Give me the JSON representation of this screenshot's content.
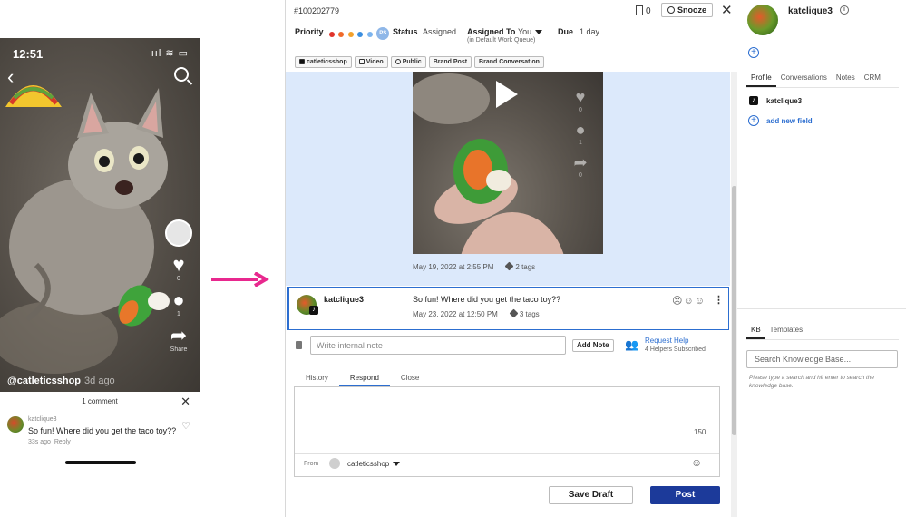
{
  "phone": {
    "time": "12:51",
    "status_icons": "ııl ≋ ▭",
    "handle": "@catleticsshop",
    "handle_age": "3d ago",
    "like_count": "0",
    "comment_count": "1",
    "share_label": "Share",
    "comments_sheet": {
      "title": "1 comment",
      "username": "katclique3",
      "text": "So fun! Where did you get the taco toy??",
      "age": "33s ago",
      "reply_label": "Reply"
    }
  },
  "ticket": {
    "id": "#100202779",
    "bookmark_count": "0",
    "snooze_label": "Snooze",
    "priority_label": "Priority",
    "priority_dots": [
      "#e0342b",
      "#f06a2b",
      "#f3a12b",
      "#3a8ee0",
      "#7cb4ee"
    ],
    "priority_avatar": "PS",
    "status_label": "Status",
    "status_value": "Assigned",
    "assigned_label": "Assigned To",
    "assigned_value": "You",
    "assigned_sub": "(in Default Work Queue)",
    "due_label": "Due",
    "due_value": "1 day",
    "tags": [
      "catleticsshop",
      "Video",
      "Public",
      "Brand Post",
      "Brand Conversation"
    ],
    "post": {
      "date": "May 19, 2022 at 2:55 PM",
      "tag_count": "2 tags",
      "like_count": "0",
      "comment_count": "1",
      "share_count": "0"
    },
    "comment": {
      "username": "katclique3",
      "text": "So fun! Where did you get the taco toy??",
      "date": "May 23, 2022 at 12:50 PM",
      "tag_count": "3 tags"
    },
    "note_placeholder": "Write internal note",
    "add_note_label": "Add Note",
    "request_help_label": "Request Help",
    "helpers_label": "4 Helpers Subscribed",
    "tabs": [
      "History",
      "Respond",
      "Close"
    ],
    "active_tab": "Respond",
    "char_count": "150",
    "from_label": "From",
    "from_account": "catleticsshop",
    "save_draft_label": "Save Draft",
    "post_label": "Post"
  },
  "profile": {
    "name": "katclique3",
    "tabs": [
      "Profile",
      "Conversations",
      "Notes",
      "CRM"
    ],
    "active_tab": "Profile",
    "tiktok_handle": "katclique3",
    "add_field_label": "add new field",
    "kb_tabs": [
      "KB",
      "Templates"
    ],
    "kb_search_placeholder": "Search Knowledge Base...",
    "kb_hint": "Please type a search and hit enter to search the knowledge base."
  },
  "colors": {
    "accent": "#2c6ed0",
    "post_button": "#1c3a9a",
    "arrow": "#e8288e",
    "conversation_bg": "#dce9fb"
  }
}
